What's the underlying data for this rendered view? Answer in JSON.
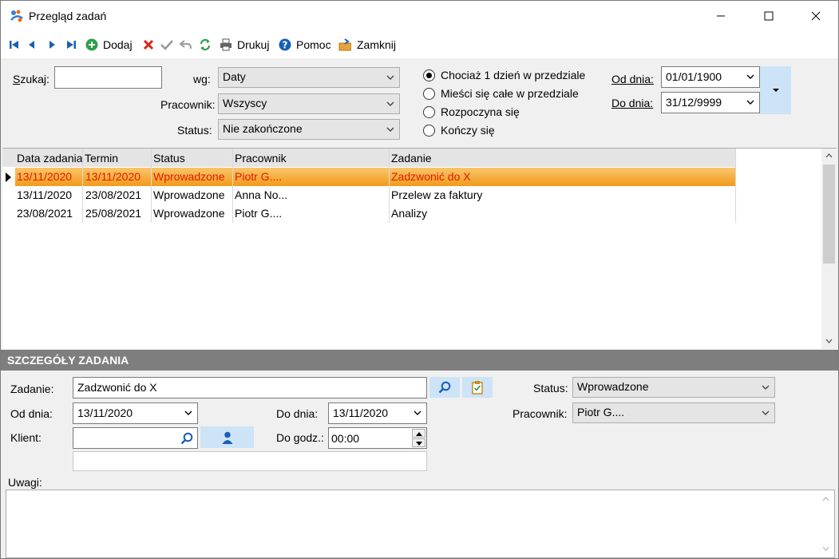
{
  "window": {
    "title": "Przegląd zadań"
  },
  "toolbar": {
    "add_label": "Dodaj",
    "print_label": "Drukuj",
    "help_label": "Pomoc",
    "close_label": "Zamknij"
  },
  "filters": {
    "search_label": "Szukaj:",
    "search_value": "",
    "by_label": "wg:",
    "by_value": "Daty",
    "employee_label": "Pracownik:",
    "employee_value": "Wszyscy",
    "status_label": "Status:",
    "status_value": "Nie zakończone",
    "radios": [
      {
        "label": "Chociaż 1 dzień w przedziale",
        "checked": true
      },
      {
        "label": "Mieści się całe w przedziale",
        "checked": false
      },
      {
        "label": "Rozpoczyna się",
        "checked": false
      },
      {
        "label": "Kończy się",
        "checked": false
      }
    ],
    "from_label": "Od dnia:",
    "from_value": "01/01/1900",
    "to_label": "Do dnia:",
    "to_value": "31/12/9999"
  },
  "grid": {
    "columns": [
      "Data zadania",
      "Termin",
      "Status",
      "Pracownik",
      "Zadanie"
    ],
    "rows": [
      {
        "date": "13/11/2020",
        "due": "13/11/2020",
        "status": "Wprowadzone",
        "employee": "Piotr G....",
        "task": "Zadzwonić do X",
        "selected": true
      },
      {
        "date": "13/11/2020",
        "due": "23/08/2021",
        "status": "Wprowadzone",
        "employee": "Anna No...",
        "task": "Przelew za faktury",
        "selected": false
      },
      {
        "date": "23/08/2021",
        "due": "25/08/2021",
        "status": "Wprowadzone",
        "employee": "Piotr G....",
        "task": "Analizy",
        "selected": false
      }
    ]
  },
  "details": {
    "section_title": "SZCZEGÓŁY ZADANIA",
    "task_label": "Zadanie:",
    "task_value": "Zadzwonić do X",
    "from_label": "Od dnia:",
    "from_value": "13/11/2020",
    "to_label": "Do dnia:",
    "to_value": "13/11/2020",
    "client_label": "Klient:",
    "client_value": "",
    "time_label": "Do godz.:",
    "time_value": "00:00",
    "status_label": "Status:",
    "status_value": "Wprowadzone",
    "employee_label": "Pracownik:",
    "employee_value": "Piotr G....",
    "notes_label": "Uwagi:",
    "notes_value": ""
  },
  "colors": {
    "selected_row_text": "#e21b00",
    "selection_gradient_top": "#f9c66b",
    "selection_gradient_bottom": "#f29a1b",
    "section_bar": "#7e7e7e",
    "accent_button": "#cde3f7",
    "nav_icon": "#1a5fb4",
    "delete_icon": "#d9261c",
    "add_icon": "#2e9f4b"
  }
}
